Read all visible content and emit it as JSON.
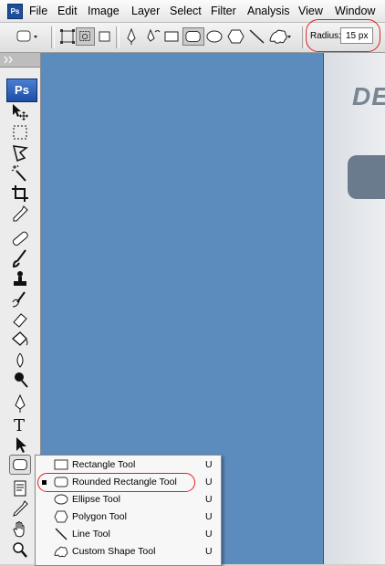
{
  "menubar": {
    "items": [
      "File",
      "Edit",
      "Image",
      "Layer",
      "Select",
      "Filter",
      "Analysis",
      "View",
      "Window"
    ]
  },
  "options": {
    "radius_label": "Radius:",
    "radius_value": "15 px"
  },
  "toolbox": {
    "logo": "Ps",
    "tools": [
      "move-icon",
      "marquee-icon",
      "lasso-icon",
      "magic-wand-icon",
      "crop-icon",
      "eyedropper-icon",
      "healing-brush-icon",
      "brush-icon",
      "clone-stamp-icon",
      "history-brush-icon",
      "eraser-icon",
      "paint-bucket-icon",
      "blur-icon",
      "dodge-icon",
      "pen-icon",
      "type-icon",
      "path-selection-icon",
      "rounded-rectangle-icon",
      "notes-icon",
      "eyedropper2-icon",
      "hand-icon",
      "zoom-icon"
    ]
  },
  "flyout": {
    "items": [
      {
        "label": "Rectangle Tool",
        "key": "U",
        "icon": "rectangle-icon",
        "active": false
      },
      {
        "label": "Rounded Rectangle Tool",
        "key": "U",
        "icon": "rounded-rectangle-icon",
        "active": true
      },
      {
        "label": "Ellipse Tool",
        "key": "U",
        "icon": "ellipse-icon",
        "active": false
      },
      {
        "label": "Polygon Tool",
        "key": "U",
        "icon": "polygon-icon",
        "active": false
      },
      {
        "label": "Line Tool",
        "key": "U",
        "icon": "line-icon",
        "active": false
      },
      {
        "label": "Custom Shape Tool",
        "key": "U",
        "icon": "custom-shape-icon",
        "active": false
      }
    ]
  },
  "document": {
    "partial_text": "DE"
  },
  "colors": {
    "canvas": "#5c8bbd",
    "highlight": "#e02020"
  }
}
